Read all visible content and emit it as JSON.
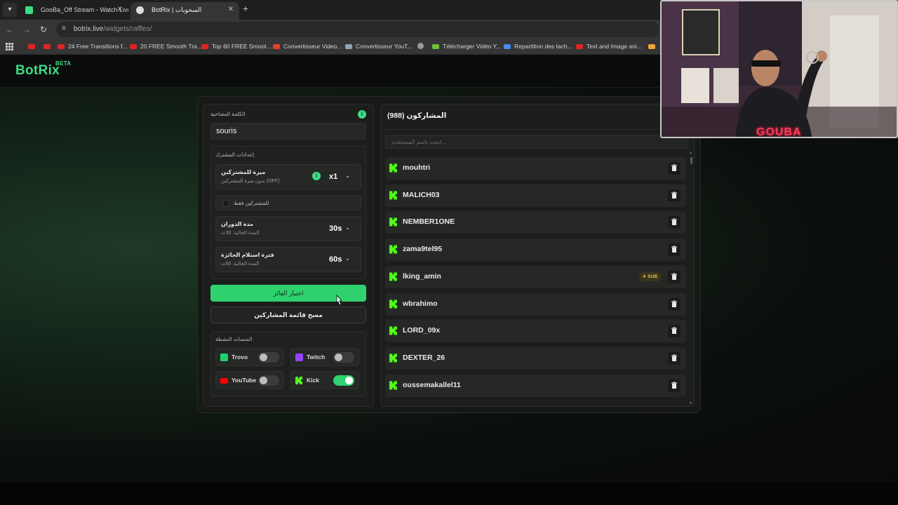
{
  "browser": {
    "tabs": [
      {
        "title": "GooBa_Off Stream - Watch Live",
        "active": false,
        "favicon_color": "#3ddc84"
      },
      {
        "title": "BotRix | السحوبات",
        "active": true,
        "favicon_color": "#dddddd"
      }
    ],
    "url_host": "botrix.live",
    "url_path": "/widgets/raffles/",
    "bookmarks": [
      "24 Free Transitions f...",
      "20 FREE Smooth Tra...",
      "Top 60 FREE Smoot...",
      "Convertisseur Video...",
      "Convertisseur YouT...",
      "Télécharger Vidéo Y...",
      "Repartition des tach...",
      "Text and Image ani..."
    ]
  },
  "app": {
    "logo": "BotRix",
    "logo_badge": "BETA"
  },
  "left_panel": {
    "keyword_label": "الكلمة المفتاحية",
    "keyword_value": "souris",
    "settings_label": "إعدادات المشترك",
    "sub_advantage": {
      "title": "ميزة للمشتركين",
      "subtitle": "بدون ميزة للمشتركين (OFF)",
      "value": "x1"
    },
    "subscribers_only_label": "للمشتركين فقط",
    "spin_duration": {
      "title": "مدة الدوران",
      "subtitle": "المدة الحالية: 30ث",
      "value": "30s"
    },
    "claim_period": {
      "title": "فترة استلام الجائزة",
      "subtitle": "المدة الحالية: 60ث",
      "value": "60s"
    },
    "pick_winner_button": "اختيار الفائز",
    "clear_list_button": "مسح قائمة المشاركين",
    "platforms_label": "المنصات النشطة",
    "platforms": [
      {
        "name": "Trovo",
        "enabled": false,
        "color": "#19d66b"
      },
      {
        "name": "Twitch",
        "enabled": false,
        "color": "#9146ff"
      },
      {
        "name": "YouTube",
        "enabled": false,
        "color": "#ff0000"
      },
      {
        "name": "Kick",
        "enabled": true,
        "color": "#53fc18"
      }
    ]
  },
  "right_panel": {
    "title": "المشاركون (988)",
    "search_placeholder": "ابحث باسم المستخدم...",
    "participants": [
      {
        "username": "mouhtri",
        "badge": ""
      },
      {
        "username": "MALICH03",
        "badge": ""
      },
      {
        "username": "NEMBER1ONE",
        "badge": ""
      },
      {
        "username": "zama9tel95",
        "badge": ""
      },
      {
        "username": "lking_amin",
        "badge": "SUB"
      },
      {
        "username": "wbrahimo",
        "badge": ""
      },
      {
        "username": "LORD_09x",
        "badge": ""
      },
      {
        "username": "DEXTER_26",
        "badge": ""
      },
      {
        "username": "oussemakallel11",
        "badge": ""
      }
    ]
  },
  "webcam": {
    "overlay_name": "GOUBA"
  },
  "colors": {
    "accent": "#3ddc84",
    "button_green": "#2fd26e",
    "kick_green": "#53fc18"
  }
}
